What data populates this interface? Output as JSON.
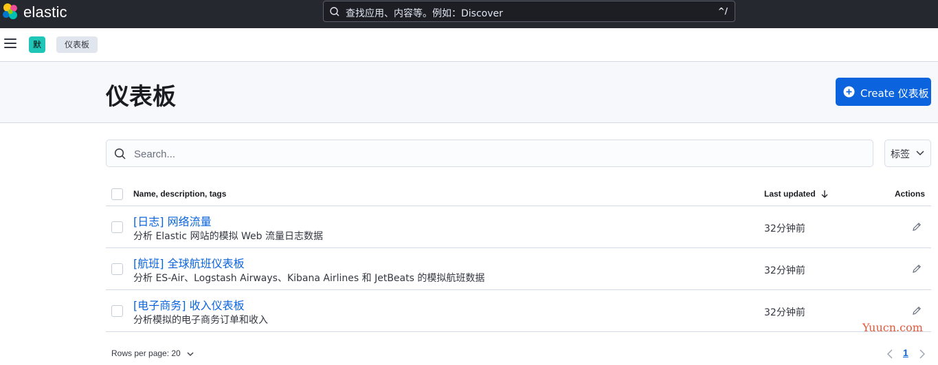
{
  "header": {
    "logo_text": "elastic",
    "search_placeholder": "查找应用、内容等。例如：Discover",
    "search_shortcut": "^/"
  },
  "subbar": {
    "space_initial": "默",
    "breadcrumb": "仪表板"
  },
  "page": {
    "title": "仪表板",
    "create_label": "Create 仪表板"
  },
  "search": {
    "placeholder": "Search...",
    "tags_label": "标签"
  },
  "table": {
    "columns": {
      "name": "Name, description, tags",
      "updated": "Last updated",
      "actions": "Actions"
    },
    "rows": [
      {
        "title": "[日志] 网络流量",
        "description": "分析 Elastic 网站的模拟 Web 流量日志数据",
        "updated": "32分钟前"
      },
      {
        "title": "[航班] 全球航班仪表板",
        "description": "分析 ES-Air、Logstash Airways、Kibana Airlines 和 JetBeats 的模拟航班数据",
        "updated": "32分钟前"
      },
      {
        "title": "[电子商务] 收入仪表板",
        "description": "分析模拟的电子商务订单和收入",
        "updated": "32分钟前"
      }
    ]
  },
  "footer": {
    "rows_per_page": "Rows per page: 20",
    "current_page": "1"
  },
  "watermark": "Yuucn.com",
  "colors": {
    "header_bg": "#25282f",
    "primary": "#0b64dd",
    "space_avatar": "#1fc6b8",
    "watermark": "#e05a3a"
  }
}
